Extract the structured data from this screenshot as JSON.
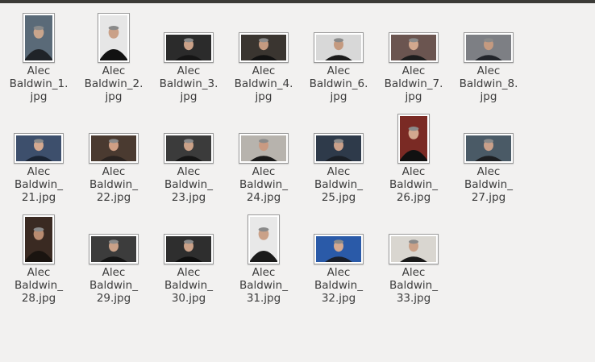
{
  "files": [
    {
      "name": "Alec\nBaldwin_1.\njpg",
      "bg": "#5a6a78",
      "fg": "#c9a58c",
      "suit": "#1f2328",
      "shape": "portrait"
    },
    {
      "name": "Alec\nBaldwin_2.\njpg",
      "bg": "#e6e6e6",
      "fg": "#caa188",
      "suit": "#111111",
      "shape": "portrait"
    },
    {
      "name": "Alec\nBaldwin_3.\njpg",
      "bg": "#2b2b2b",
      "fg": "#caa188",
      "suit": "#151515",
      "shape": "wide"
    },
    {
      "name": "Alec\nBaldwin_4.\njpg",
      "bg": "#3a3530",
      "fg": "#c49a80",
      "suit": "#121212",
      "shape": "wide"
    },
    {
      "name": "Alec\nBaldwin_6.\njpg",
      "bg": "#d8d8d8",
      "fg": "#c49a80",
      "suit": "#1b1b1b",
      "shape": "wide"
    },
    {
      "name": "Alec\nBaldwin_7.\njpg",
      "bg": "#6b5550",
      "fg": "#d2a88e",
      "suit": "#1d1d1d",
      "shape": "wide"
    },
    {
      "name": "Alec\nBaldwin_8.\njpg",
      "bg": "#7d7f84",
      "fg": "#c49a80",
      "suit": "#22252b",
      "shape": "wide"
    },
    {
      "name": "Alec\nBaldwin_\n21.jpg",
      "bg": "#3d4f6c",
      "fg": "#d4a990",
      "suit": "#1a2434",
      "shape": "wide"
    },
    {
      "name": "Alec\nBaldwin_\n22.jpg",
      "bg": "#4a3a30",
      "fg": "#cf9f84",
      "suit": "#2a2320",
      "shape": "wide"
    },
    {
      "name": "Alec\nBaldwin_\n23.jpg",
      "bg": "#3b3b3b",
      "fg": "#caa188",
      "suit": "#151515",
      "shape": "wide"
    },
    {
      "name": "Alec\nBaldwin_\n24.jpg",
      "bg": "#b7b3ad",
      "fg": "#c99a82",
      "suit": "#1a1a1a",
      "shape": "wide"
    },
    {
      "name": "Alec\nBaldwin_\n25.jpg",
      "bg": "#2e3a4a",
      "fg": "#c9a08a",
      "suit": "#1a1f26",
      "shape": "wide"
    },
    {
      "name": "Alec\nBaldwin_\n26.jpg",
      "bg": "#7a2a24",
      "fg": "#d2a88e",
      "suit": "#111111",
      "shape": "portrait"
    },
    {
      "name": "Alec\nBaldwin_\n27.jpg",
      "bg": "#4a5a66",
      "fg": "#c9a08a",
      "suit": "#1d1f22",
      "shape": "wide"
    },
    {
      "name": "Alec\nBaldwin_\n28.jpg",
      "bg": "#3a2a22",
      "fg": "#b98b70",
      "suit": "#1a1410",
      "shape": "portrait"
    },
    {
      "name": "Alec\nBaldwin_\n29.jpg",
      "bg": "#3c3c3c",
      "fg": "#caa188",
      "suit": "#151515",
      "shape": "wide"
    },
    {
      "name": "Alec\nBaldwin_\n30.jpg",
      "bg": "#2e2e2e",
      "fg": "#caa188",
      "suit": "#0f0f0f",
      "shape": "wide"
    },
    {
      "name": "Alec\nBaldwin_\n31.jpg",
      "bg": "#e8e8e8",
      "fg": "#caa188",
      "suit": "#1a1a1a",
      "shape": "portrait"
    },
    {
      "name": "Alec\nBaldwin_\n32.jpg",
      "bg": "#2a5aa8",
      "fg": "#d4a990",
      "suit": "#1a1f2a",
      "shape": "wide"
    },
    {
      "name": "Alec\nBaldwin_\n33.jpg",
      "bg": "#d9d6d0",
      "fg": "#caa188",
      "suit": "#1a1a1a",
      "shape": "wide"
    }
  ]
}
